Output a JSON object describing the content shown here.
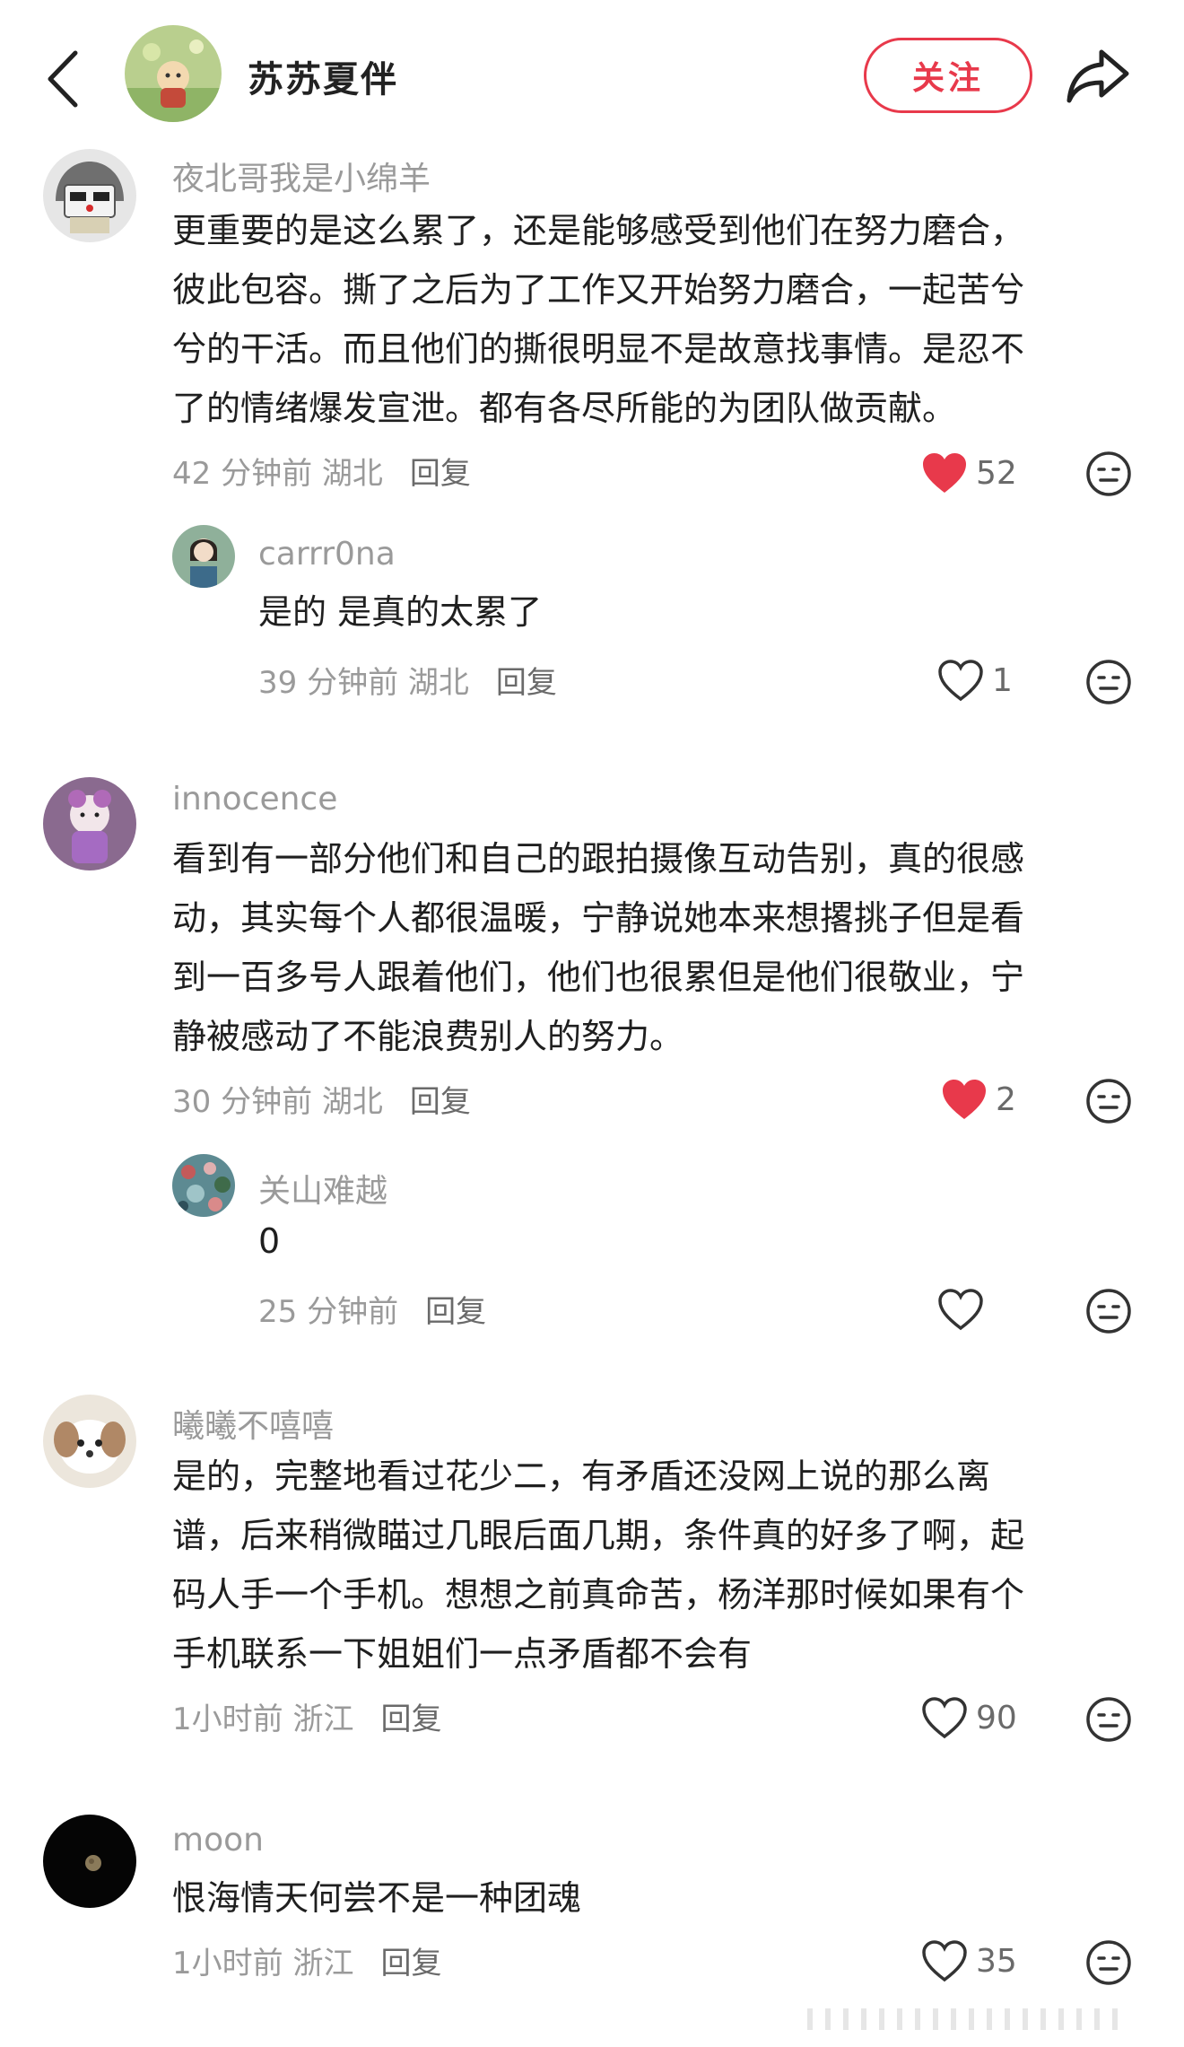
{
  "header": {
    "title": "苏苏夏伴",
    "follow_label": "关注"
  },
  "comments": [
    {
      "username": "夜北哥我是小绵羊",
      "lines": [
        "更重要的是这么累了，还是能够感受到他们在努力磨合，",
        "彼此包容。撕了之后为了工作又开始努力磨合，一起苦兮",
        "兮的干活。而且他们的撕很明显不是故意找事情。是忍不",
        "了的情绪爆发宣泄。都有各尽所能的为团队做贡献。"
      ],
      "time_location": "42 分钟前  湖北",
      "reply_label": "回复",
      "likes": "52",
      "liked": true
    },
    {
      "username": "carrr0na",
      "lines": [
        "是的 是真的太累了"
      ],
      "time_location": "39 分钟前  湖北",
      "reply_label": "回复",
      "likes": "1",
      "liked": false
    },
    {
      "username": "innocence",
      "lines": [
        "看到有一部分他们和自己的跟拍摄像互动告别，真的很感",
        "动，其实每个人都很温暖，宁静说她本来想撂挑子但是看",
        "到一百多号人跟着他们，他们也很累但是他们很敬业，宁",
        "静被感动了不能浪费别人的努力。"
      ],
      "time_location": "30 分钟前  湖北",
      "reply_label": "回复",
      "likes": "2",
      "liked": true
    },
    {
      "username": "关山难越",
      "lines": [
        "0"
      ],
      "time_location": "25 分钟前",
      "reply_label": "回复",
      "likes": "",
      "liked": false
    },
    {
      "username": "曦曦不嘻嘻",
      "lines": [
        "是的，完整地看过花少二，有矛盾还没网上说的那么离",
        "谱，后来稍微瞄过几眼后面几期，条件真的好多了啊，起",
        "码人手一个手机。想想之前真命苦，杨洋那时候如果有个",
        "手机联系一下姐姐们一点矛盾都不会有"
      ],
      "time_location": "1小时前  浙江",
      "reply_label": "回复",
      "likes": "90",
      "liked": false
    },
    {
      "username": "moon",
      "lines": [
        "恨海情天何尝不是一种团魂"
      ],
      "time_location": "1小时前  浙江",
      "reply_label": "回复",
      "likes": "35",
      "liked": false
    }
  ],
  "colors": {
    "accent": "#e8394b",
    "meta": "#9a9a9a"
  },
  "icons": {
    "back": "chevron-left-icon",
    "share": "share-arrow-icon",
    "like": "heart-icon",
    "emoji": "emoji-face-icon"
  }
}
